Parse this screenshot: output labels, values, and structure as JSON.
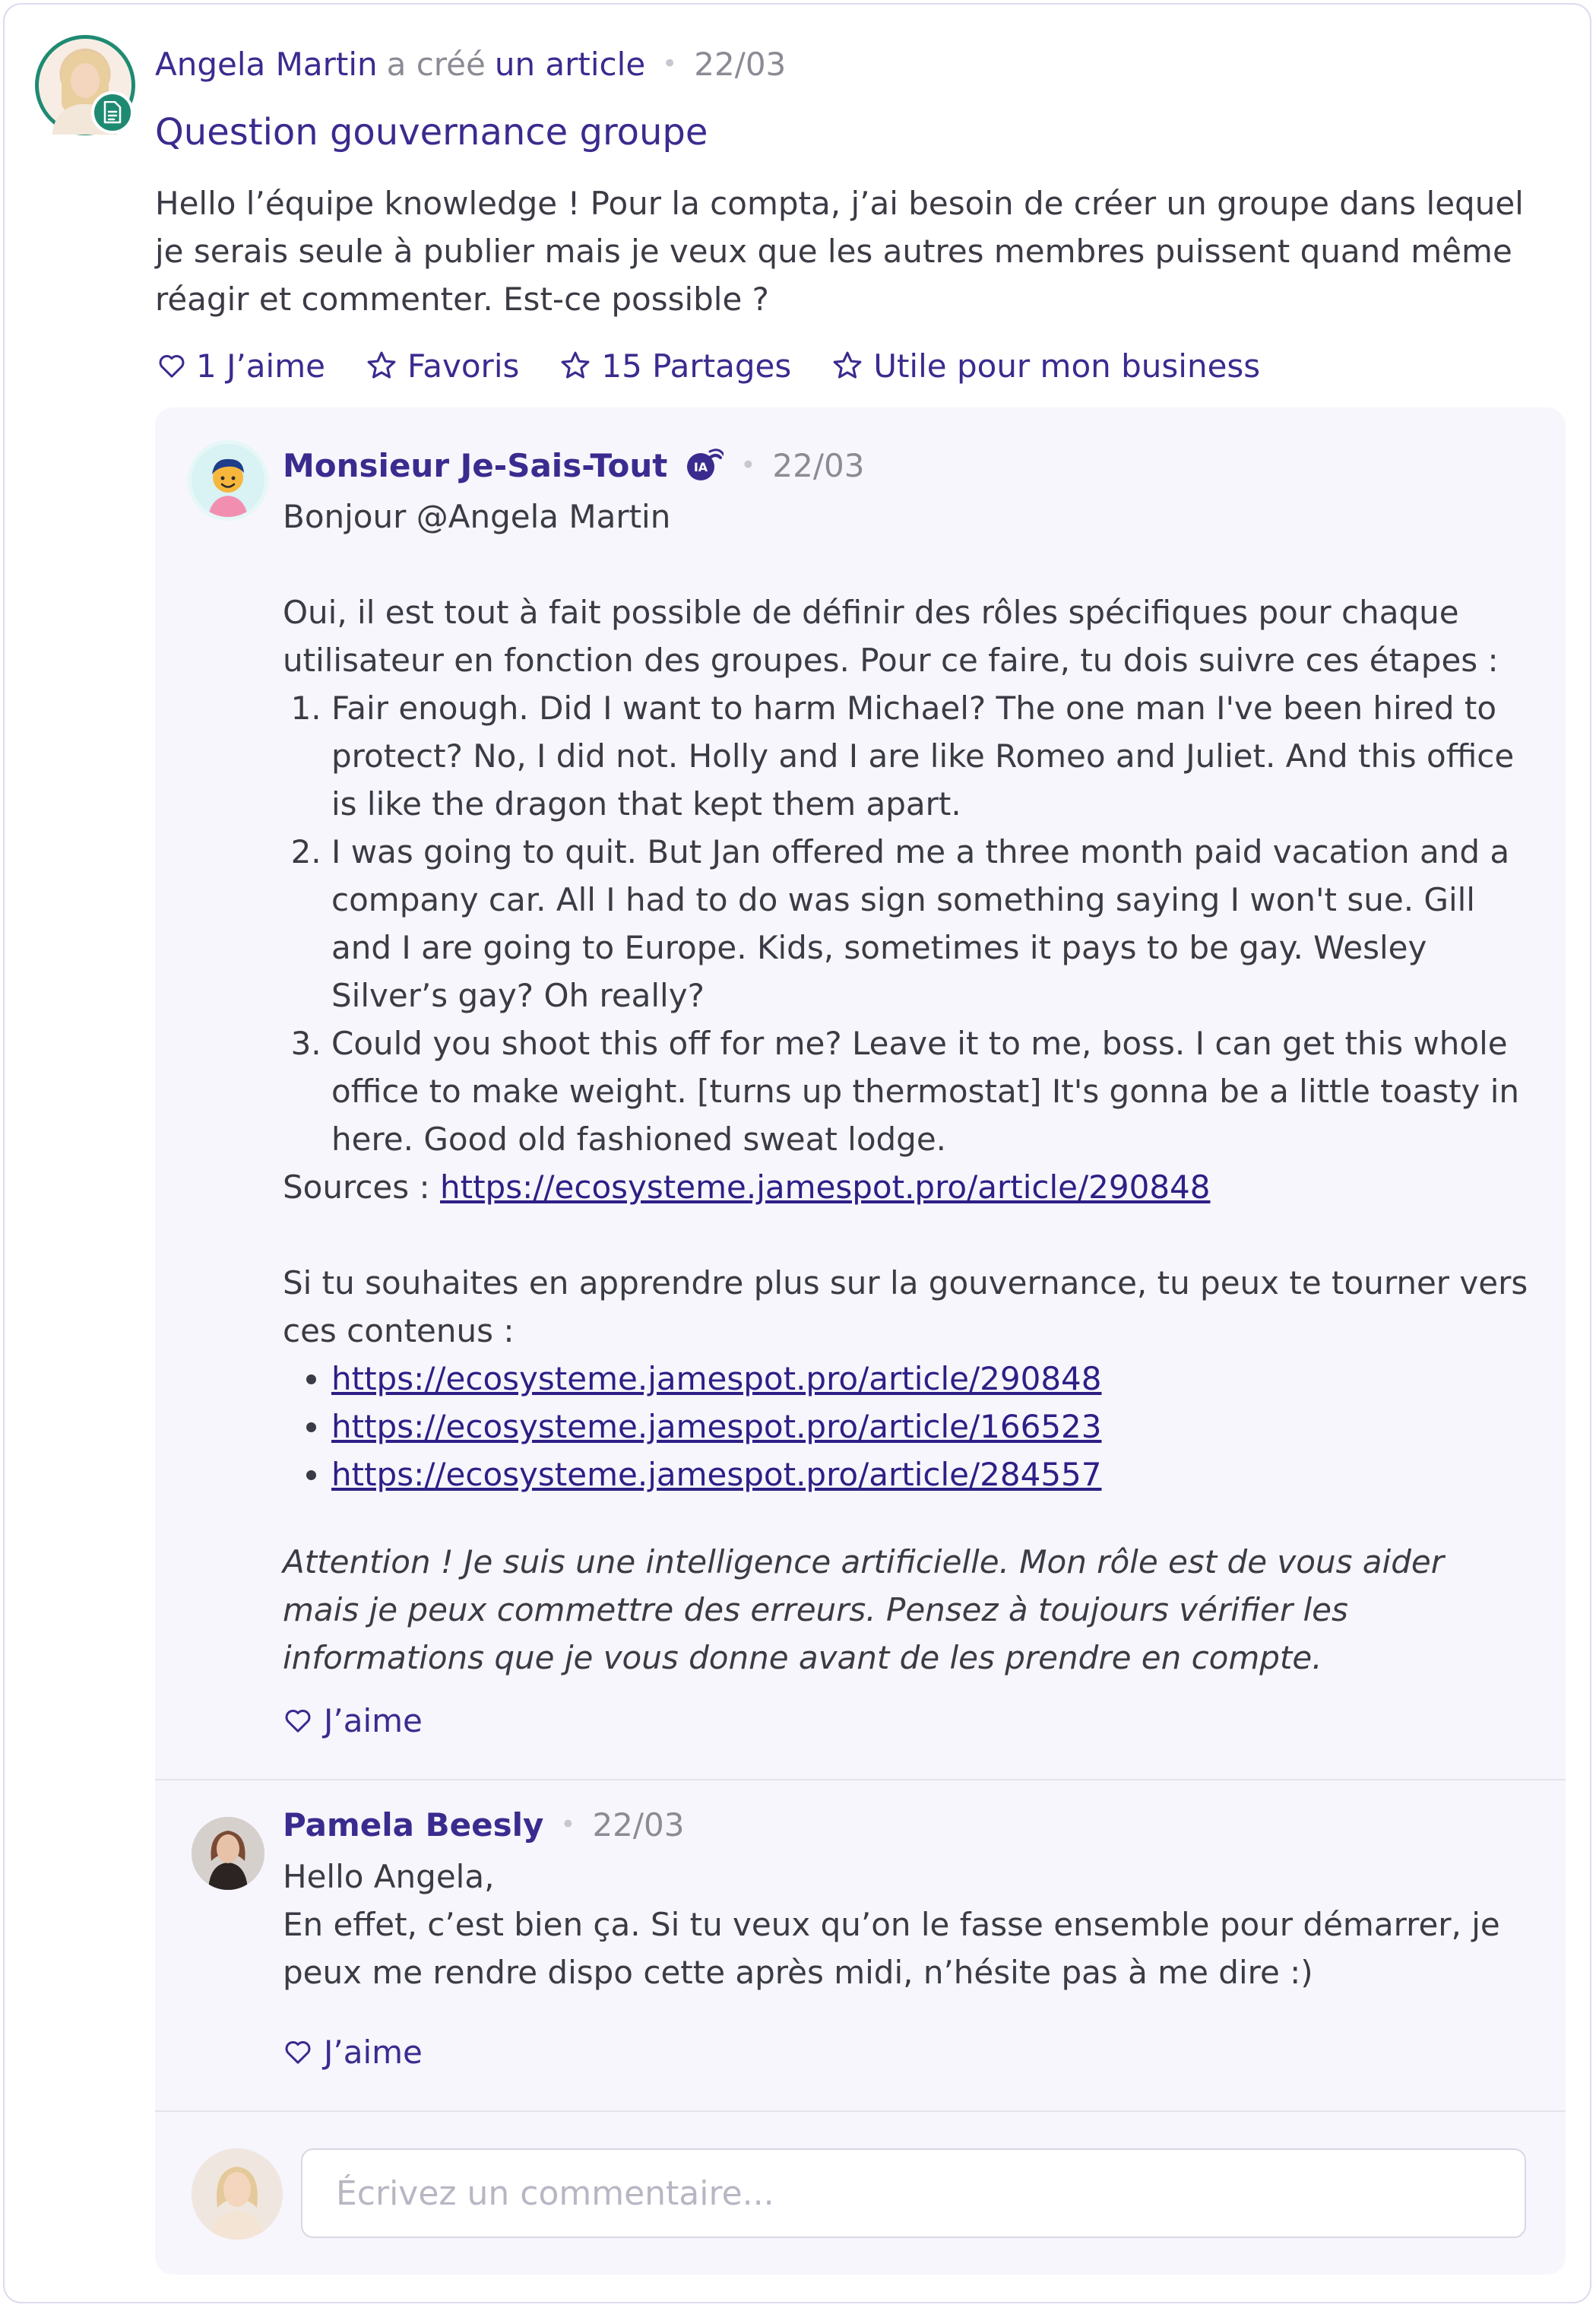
{
  "post": {
    "author": "Angela Martin",
    "created_text": "a créé",
    "object_link": "un article",
    "date": "22/03",
    "title": "Question gouvernance groupe",
    "body": "Hello l’équipe knowledge ! Pour la compta, j’ai besoin de créer un groupe dans lequel je serais seule à publier mais je veux que les autres membres puissent quand même réagir et commenter. Est-ce possible ?",
    "actions": {
      "like": "1 J’aime",
      "favorites": "Favoris",
      "shares": "15 Partages",
      "useful": "Utile pour mon business"
    },
    "avatar_icon": "user-avatar",
    "badge_icon": "document-icon"
  },
  "comments": [
    {
      "author": "Monsieur Je-Sais-Tout",
      "badge": "IA",
      "date": "22/03",
      "greeting": "Bonjour @Angela Martin",
      "intro": "Oui, il est tout à fait possible de définir des rôles spécifiques pour chaque utilisateur en fonction des groupes. Pour ce faire, tu dois suivre ces étapes :",
      "steps": [
        "Fair enough. Did I want to harm Michael? The one man I've been hired to protect? No, I did not. Holly and I are like Romeo and Juliet. And this office is like the dragon that kept them apart.",
        "I was going to quit. But Jan offered me a three month paid vacation and a company car. All I had to do was sign something saying I won't sue. Gill and I are going to Europe. Kids, sometimes it pays to be gay. Wesley Silver’s gay? Oh really?",
        "Could you shoot this off for me? Leave it to me, boss. I can get this whole office to make weight. [turns up thermostat] It's gonna be a little toasty in here. Good old fashioned sweat lodge."
      ],
      "sources_label": "Sources :",
      "sources_link": "https://ecosysteme.jamespot.pro/article/290848",
      "more_text": "Si tu souhaites en apprendre plus sur la gouvernance, tu peux te tourner vers ces contenus :",
      "more_links": [
        "https://ecosysteme.jamespot.pro/article/290848",
        "https://ecosysteme.jamespot.pro/article/166523",
        "https://ecosysteme.jamespot.pro/article/284557"
      ],
      "warning": "Attention ! Je suis une intelligence artificielle. Mon rôle est de vous aider mais je peux commettre des erreurs. Pensez à toujours vérifier les informations que je vous donne avant de les prendre en compte.",
      "like": "J’aime"
    },
    {
      "author": "Pamela Beesly",
      "date": "22/03",
      "line1": "Hello Angela,",
      "line2": "En effet, c’est bien ça. Si tu veux qu’on le fasse ensemble pour démarrer, je peux me rendre dispo cette après midi, n’hésite pas à me dire :)",
      "like": "J’aime"
    }
  ],
  "composer": {
    "placeholder": "Écrivez un commentaire..."
  },
  "colors": {
    "accent": "#3a2b8f",
    "teal": "#1f8a72",
    "panel": "#f6f6fc",
    "text": "#3b3b46",
    "muted": "#8b8b95"
  }
}
